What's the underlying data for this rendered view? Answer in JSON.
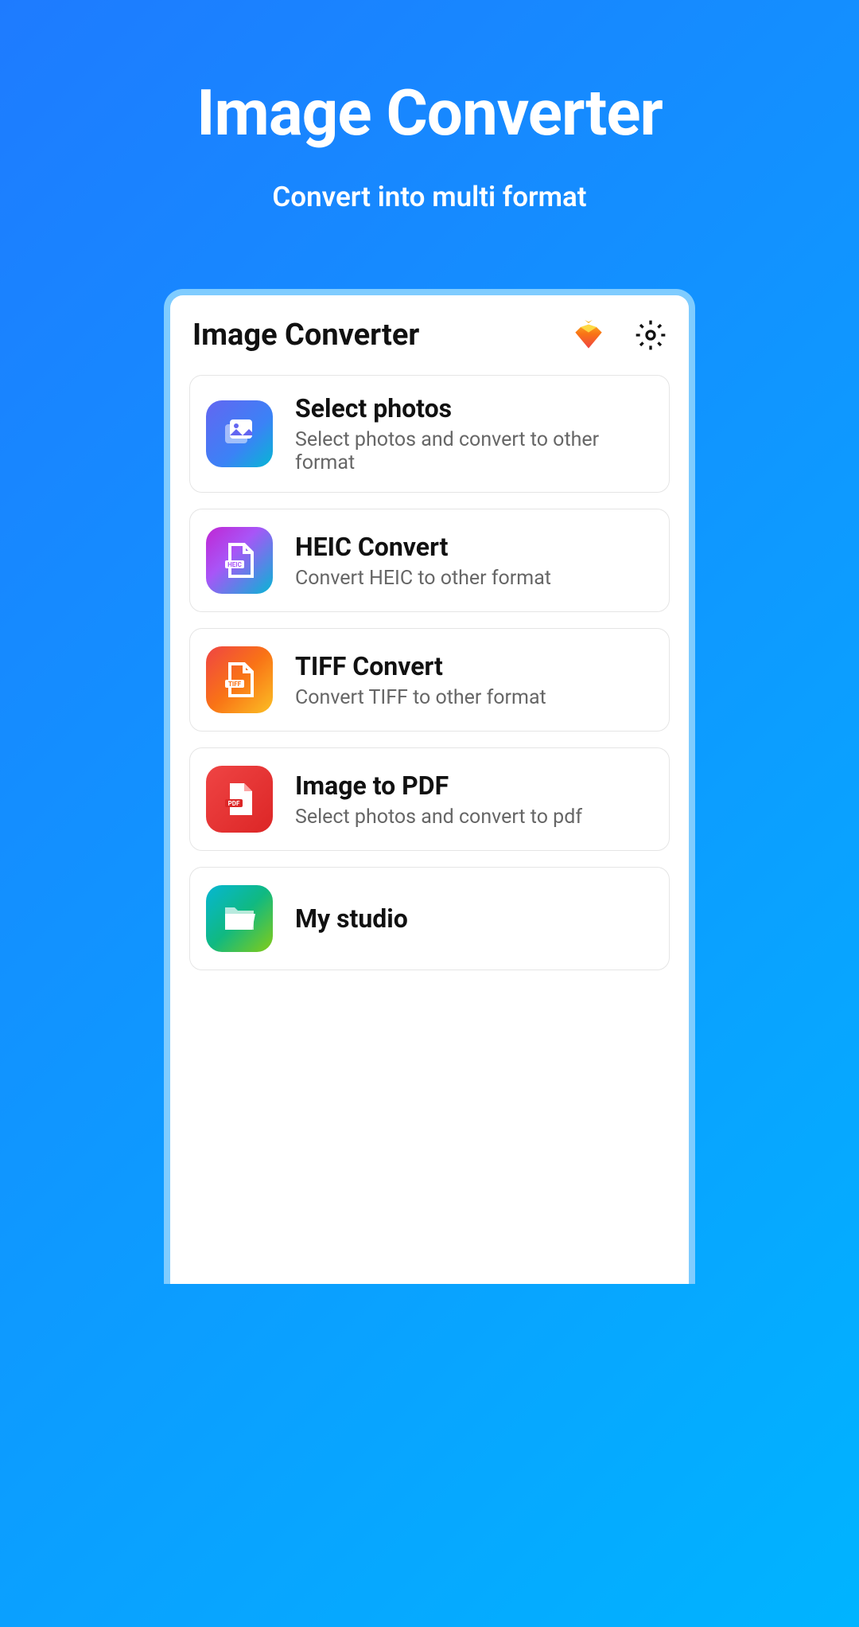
{
  "promo": {
    "title": "Image Converter",
    "subtitle": "Convert into multi format"
  },
  "app": {
    "title": "Image Converter"
  },
  "cards": {
    "select_photos": {
      "title": "Select photos",
      "subtitle": "Select photos and convert to other format"
    },
    "heic": {
      "title": "HEIC Convert",
      "subtitle": "Convert HEIC to other format"
    },
    "tiff": {
      "title": "TIFF Convert",
      "subtitle": "Convert TIFF to other format"
    },
    "pdf": {
      "title": "Image to PDF",
      "subtitle": "Select photos and convert to pdf"
    },
    "studio": {
      "title": "My studio"
    }
  }
}
